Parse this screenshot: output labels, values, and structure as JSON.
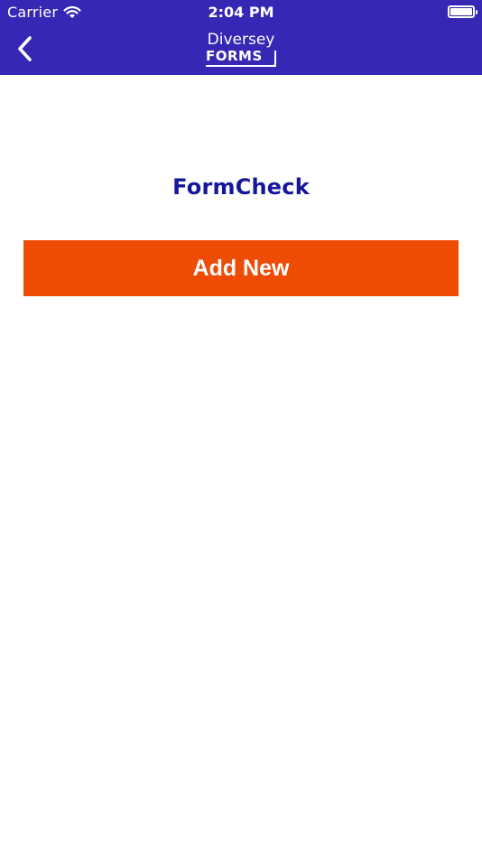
{
  "status_bar": {
    "carrier": "Carrier",
    "time": "2:04 PM",
    "icons": [
      "wifi-icon",
      "battery-icon"
    ]
  },
  "nav": {
    "back_icon": "chevron-left-icon",
    "logo_line1": "Diversey",
    "logo_line2": "FORMS"
  },
  "page": {
    "title": "FormCheck",
    "add_button_label": "Add New"
  },
  "colors": {
    "header_bg": "#3627b4",
    "title_text": "#16179a",
    "button_bg": "#ee4b05",
    "button_text": "#ffffff",
    "page_bg": "#ffffff"
  }
}
